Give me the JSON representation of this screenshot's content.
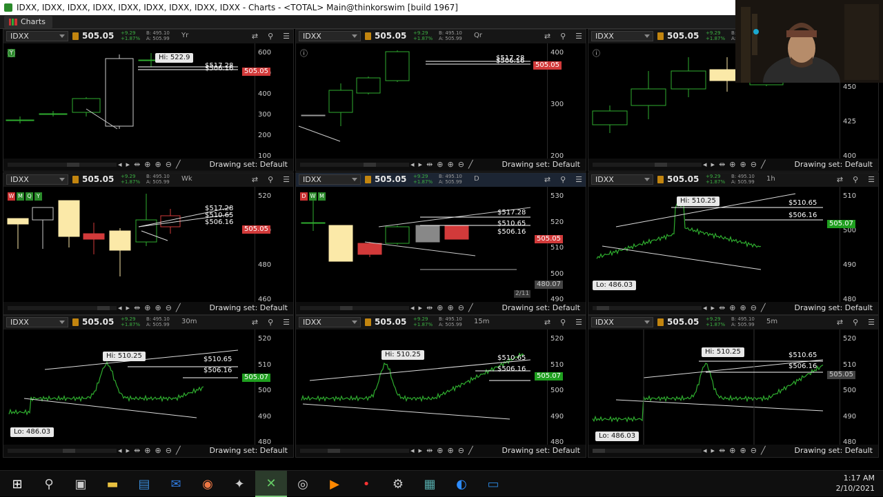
{
  "window_title": "IDXX, IDXX, IDXX, IDXX, IDXX, IDXX, IDXX, IDXX, IDXX - Charts - <TOTAL> Main@thinkorswim [build 1967]",
  "tab_label": "Charts",
  "common": {
    "symbol": "IDXX",
    "price": "505.05",
    "chg1": "+9.29",
    "chg2": "+1.87%",
    "bid": "B: 495.10",
    "ask": "A: 505.99",
    "drawing_set": "Drawing set: Default"
  },
  "panels": [
    {
      "tf": "Yr",
      "yaxis": [
        "600",
        "500",
        "400",
        "300",
        "200",
        "100"
      ],
      "labels": [
        {
          "t": "Hi: 522.9",
          "k": "box"
        },
        {
          "t": "$517.28",
          "k": "line"
        },
        {
          "t": "$506.16",
          "k": "line"
        },
        {
          "t": "505.05",
          "k": "price"
        }
      ],
      "corner": "Y"
    },
    {
      "tf": "Qr",
      "yaxis": [
        "400",
        "300",
        "200"
      ],
      "labels": [
        {
          "t": "$517.28",
          "k": "line"
        },
        {
          "t": "$506.16",
          "k": "line"
        },
        {
          "t": "505.05",
          "k": "price"
        }
      ]
    },
    {
      "tf": "Mo",
      "yaxis": [
        "475",
        "450",
        "425",
        "400"
      ],
      "labels": []
    },
    {
      "tf": "Wk",
      "yaxis": [
        "520",
        "500",
        "480",
        "460"
      ],
      "labels": [
        {
          "t": "$517.28",
          "k": "line"
        },
        {
          "t": "$510.65",
          "k": "line"
        },
        {
          "t": "$506.16",
          "k": "line"
        },
        {
          "t": "505.05",
          "k": "price"
        }
      ],
      "corner": "WMQY"
    },
    {
      "tf": "D",
      "yaxis": [
        "530",
        "520",
        "510",
        "500",
        "490"
      ],
      "labels": [
        {
          "t": "$517.28",
          "k": "line"
        },
        {
          "t": "$510.65",
          "k": "line"
        },
        {
          "t": "$506.16",
          "k": "line"
        },
        {
          "t": "505.05",
          "k": "price"
        },
        {
          "t": "480.07",
          "k": "gray"
        },
        {
          "t": "2/11",
          "k": "date"
        }
      ],
      "corner": "DWM"
    },
    {
      "tf": "1h",
      "yaxis": [
        "510",
        "500",
        "490",
        "480"
      ],
      "labels": [
        {
          "t": "Hi: 510.25",
          "k": "box"
        },
        {
          "t": "$510.65",
          "k": "line"
        },
        {
          "t": "$506.16",
          "k": "line"
        },
        {
          "t": "505.07",
          "k": "green"
        },
        {
          "t": "Lo: 486.03",
          "k": "box"
        }
      ]
    },
    {
      "tf": "30m",
      "yaxis": [
        "520",
        "510",
        "500",
        "490",
        "480"
      ],
      "labels": [
        {
          "t": "Hi: 510.25",
          "k": "box"
        },
        {
          "t": "$510.65",
          "k": "line"
        },
        {
          "t": "$506.16",
          "k": "line"
        },
        {
          "t": "505.07",
          "k": "green"
        },
        {
          "t": "Lo: 486.03",
          "k": "box"
        }
      ]
    },
    {
      "tf": "15m",
      "yaxis": [
        "520",
        "510",
        "500",
        "490",
        "480"
      ],
      "labels": [
        {
          "t": "Hi: 510.25",
          "k": "box"
        },
        {
          "t": "$510.65",
          "k": "line"
        },
        {
          "t": "$506.16",
          "k": "line"
        },
        {
          "t": "505.07",
          "k": "green"
        }
      ]
    },
    {
      "tf": "5m",
      "yaxis": [
        "520",
        "510",
        "500",
        "490",
        "480"
      ],
      "labels": [
        {
          "t": "Hi: 510.25",
          "k": "box"
        },
        {
          "t": "$510.65",
          "k": "line"
        },
        {
          "t": "$506.16",
          "k": "line"
        },
        {
          "t": "505.05",
          "k": "gray"
        },
        {
          "t": "Lo: 486.03",
          "k": "box"
        }
      ]
    }
  ],
  "taskbar": {
    "icons": [
      "windows-start-icon",
      "search-icon",
      "task-view-icon",
      "file-explorer-icon",
      "store-icon",
      "outlook-icon",
      "chrome-icon",
      "app-icon",
      "thinkorswim-icon",
      "obs-icon",
      "media-icon",
      "app-dot-icon",
      "settings-icon",
      "calculator-icon",
      "zoom-icon",
      "rdp-icon"
    ],
    "time": "1:17 AM",
    "date": "2/10/2021"
  },
  "colors": {
    "up": "#2fae2f",
    "down": "#d23a3a",
    "yellow": "#fbe9a8",
    "price_bg": "#1f9f1f",
    "accent": "#c2850f"
  }
}
